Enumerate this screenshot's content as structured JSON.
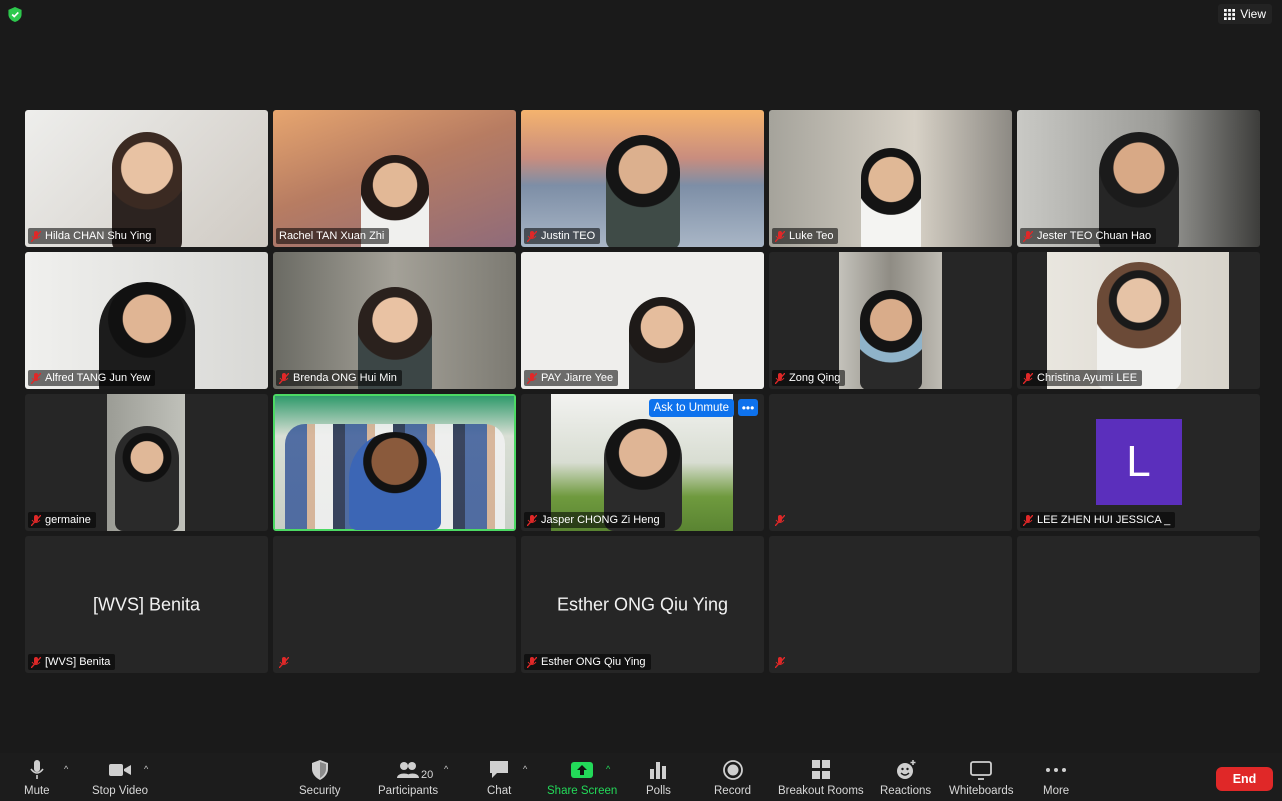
{
  "window": {
    "view_label": "View"
  },
  "participants": [
    {
      "name": "Hilda CHAN Shu Ying",
      "bg": "#dcd9d4"
    },
    {
      "name": "Rachel TAN Xuan Zhi",
      "bg": "#c98a5a"
    },
    {
      "name": "Justin TEO",
      "bg": "#8a9fb8"
    },
    {
      "name": "Luke Teo",
      "bg": "#b9b2a6"
    },
    {
      "name": "Jester TEO Chuan Hao",
      "bg": "#a7a7a2"
    },
    {
      "name": "Alfred TANG Jun Yew",
      "bg": "#e3e3e1"
    },
    {
      "name": "Brenda ONG Hui Min",
      "bg": "#8e8c85"
    },
    {
      "name": "PAY Jiarre Yee",
      "bg": "#efeeec"
    },
    {
      "name": "Zong Qing",
      "bg": "#9c9992"
    },
    {
      "name": "Christina Ayumi LEE",
      "bg": "#e2e0da"
    },
    {
      "name": "germaine",
      "bg": "#8b8c86"
    },
    {
      "name": "",
      "bg": "#cfd6cc"
    },
    {
      "name": "Jasper CHONG Zi Heng",
      "bg": "#7c9b58"
    },
    {
      "name": "",
      "bg": ""
    },
    {
      "name": "LEE ZHEN HUI JESSICA _",
      "avatar_letter": "L"
    },
    {
      "name": "[WVS] Benita",
      "big_name": "[WVS] Benita"
    },
    {
      "name": "",
      "bg": ""
    },
    {
      "name": "Esther ONG Qiu Ying",
      "big_name": "Esther ONG Qiu Ying"
    },
    {
      "name": "",
      "bg": ""
    },
    {
      "name": "",
      "bg": ""
    }
  ],
  "ask_to_unmute": {
    "label": "Ask to Unmute",
    "more": "•••"
  },
  "toolbar": {
    "mute": "Mute",
    "stop_video": "Stop Video",
    "security": "Security",
    "participants": "Participants",
    "participants_count": "20",
    "chat": "Chat",
    "share_screen": "Share Screen",
    "polls": "Polls",
    "record": "Record",
    "breakout_rooms": "Breakout Rooms",
    "reactions": "Reactions",
    "whiteboards": "Whiteboards",
    "more": "More",
    "end": "End"
  },
  "colors": {
    "accent_green": "#4cd964",
    "share_green": "#23d959",
    "end_red": "#e02828",
    "unmute_blue": "#0e72ed",
    "avatar_purple": "#5b2fbc"
  }
}
